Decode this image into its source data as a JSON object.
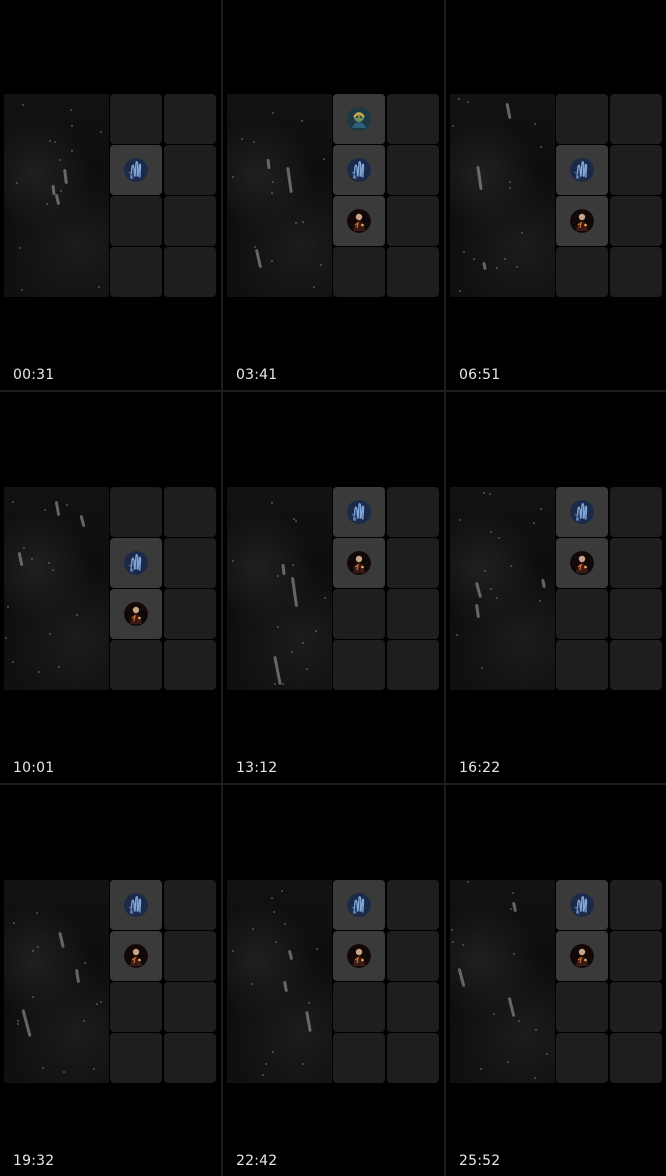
{
  "contact_sheet": {
    "frames": [
      {
        "timestamp": "00:31",
        "cells": {
          "0,1": "hand-avatar"
        }
      },
      {
        "timestamp": "03:41",
        "cells": {
          "0,0": "character-avatar",
          "0,1": "hand-avatar",
          "0,2": "figure-avatar"
        }
      },
      {
        "timestamp": "06:51",
        "cells": {
          "0,1": "hand-avatar",
          "0,2": "figure-avatar"
        }
      },
      {
        "timestamp": "10:01",
        "cells": {
          "0,1": "hand-avatar",
          "0,2": "figure-avatar"
        }
      },
      {
        "timestamp": "13:12",
        "cells": {
          "0,0": "hand-avatar",
          "0,1": "figure-avatar"
        }
      },
      {
        "timestamp": "16:22",
        "cells": {
          "0,0": "hand-avatar",
          "0,1": "figure-avatar"
        }
      },
      {
        "timestamp": "19:32",
        "cells": {
          "0,0": "hand-avatar",
          "0,1": "figure-avatar"
        }
      },
      {
        "timestamp": "22:42",
        "cells": {
          "0,0": "hand-avatar",
          "0,1": "figure-avatar"
        }
      },
      {
        "timestamp": "25:52",
        "cells": {
          "0,0": "hand-avatar",
          "0,1": "figure-avatar"
        }
      }
    ]
  },
  "colors": {
    "background": "#000000",
    "cell_empty": "#1e1e1e",
    "cell_active": "#3a3a3a",
    "timestamp_text": "#e8e8e8"
  }
}
